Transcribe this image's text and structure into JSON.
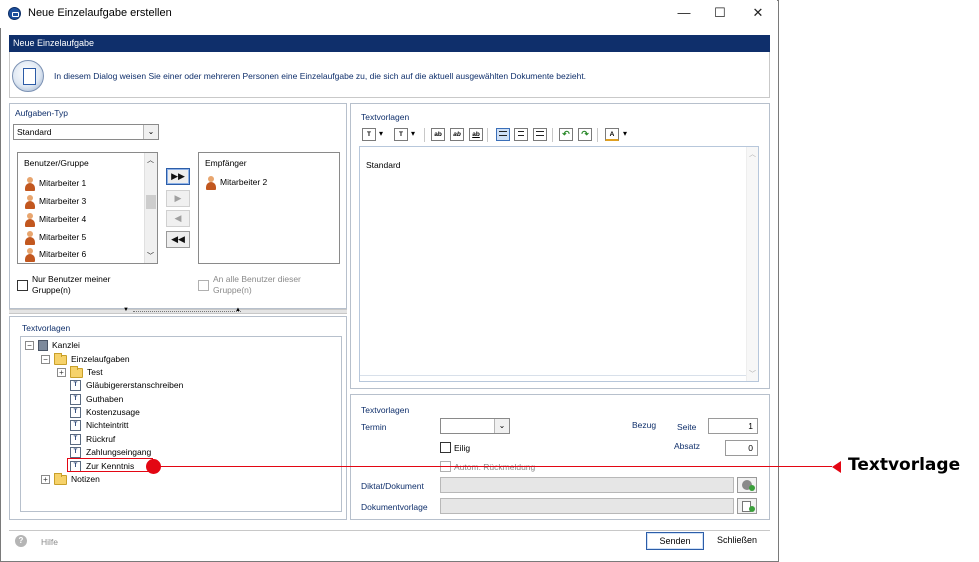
{
  "window": {
    "title": "Neue Einzelaufgabe erstellen",
    "minimize": "—",
    "maximize": "☐",
    "close": "✕"
  },
  "header": {
    "title": "Neue Einzelaufgabe",
    "info": "In diesem Dialog weisen Sie einer oder mehreren Personen eine Einzelaufgabe zu, die sich auf die aktuell ausgewählten Dokumente bezieht."
  },
  "task_type": {
    "label": "Aufgaben-Typ",
    "value": "Standard"
  },
  "users": {
    "header": "Benutzer/Gruppe",
    "items": [
      "Mitarbeiter 1",
      "Mitarbeiter 3",
      "Mitarbeiter 4",
      "Mitarbeiter 5",
      "Mitarbeiter 6"
    ]
  },
  "recipients": {
    "header": "Empfänger",
    "items": [
      "Mitarbeiter 2"
    ]
  },
  "move_buttons": [
    "▶▶",
    "▶",
    "◀",
    "◀◀"
  ],
  "options": {
    "only_my_group": "Nur Benutzer meiner Gruppe(n)",
    "only_my_group_line1": "Nur Benutzer meiner",
    "only_my_group_line2": "Gruppe(n)",
    "all_group_users_line1": "An alle Benutzer dieser",
    "all_group_users_line2": "Gruppe(n)"
  },
  "tree": {
    "label": "Textvorlagen",
    "root": "Kanzlei",
    "folder": "Einzelaufgaben",
    "subfolder": "Test",
    "items": [
      "Gläubigererstanschreiben",
      "Guthaben",
      "Kostenzusage",
      "Nichteintritt",
      "Rückruf",
      "Zahlungseingang",
      "Zur Kenntnis"
    ],
    "other_folder": "Notizen",
    "expand": "+",
    "collapse": "−",
    "doc_glyph": "T"
  },
  "editor": {
    "label": "Textvorlagen",
    "content": "Standard",
    "toolbar": {
      "font": "T",
      "size": "T",
      "bold": "ab",
      "italic": "ab",
      "underline": "ab",
      "undo": "↶",
      "redo": "↷",
      "color": "A",
      "dropdown": "▾"
    }
  },
  "details": {
    "label": "Textvorlagen",
    "termin_label": "Termin",
    "bezug_label": "Bezug",
    "seite_label": "Seite",
    "seite_value": "1",
    "absatz_label": "Absatz",
    "absatz_value": "0",
    "eilig_label": "Eilig",
    "autom_label": "Autom. Rückmeldung",
    "diktat_label": "Diktat/Dokument",
    "vorlage_label": "Dokumentvorlage"
  },
  "footer": {
    "help": "Hilfe",
    "help_glyph": "?",
    "send": "Senden",
    "close": "Schließen"
  },
  "annotation": {
    "label": "Textvorlage",
    "color": "#e30613"
  }
}
